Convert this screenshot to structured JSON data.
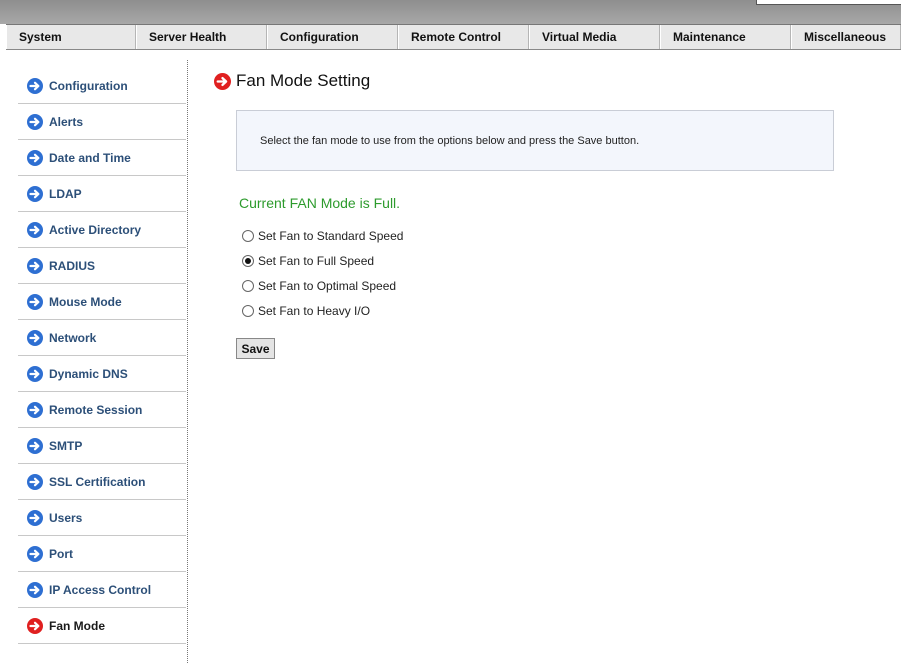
{
  "menu": [
    {
      "label": "System"
    },
    {
      "label": "Server Health"
    },
    {
      "label": "Configuration"
    },
    {
      "label": "Remote Control"
    },
    {
      "label": "Virtual Media"
    },
    {
      "label": "Maintenance"
    },
    {
      "label": "Miscellaneous"
    }
  ],
  "sidebar": {
    "items": [
      {
        "label": "Configuration"
      },
      {
        "label": "Alerts"
      },
      {
        "label": "Date and Time"
      },
      {
        "label": "LDAP"
      },
      {
        "label": "Active Directory"
      },
      {
        "label": "RADIUS"
      },
      {
        "label": "Mouse Mode"
      },
      {
        "label": "Network"
      },
      {
        "label": "Dynamic DNS"
      },
      {
        "label": "Remote Session"
      },
      {
        "label": "SMTP"
      },
      {
        "label": "SSL Certification"
      },
      {
        "label": "Users"
      },
      {
        "label": "Port"
      },
      {
        "label": "IP Access Control"
      },
      {
        "label": "Fan Mode"
      }
    ],
    "active_index": 15
  },
  "content": {
    "title": "Fan Mode Setting",
    "info": "Select the fan mode to use from the options below and press the Save button.",
    "current_mode": "Current FAN Mode is Full.",
    "options": [
      {
        "label": "Set Fan to Standard Speed",
        "checked": false
      },
      {
        "label": "Set Fan to Full Speed",
        "checked": true
      },
      {
        "label": "Set Fan to Optimal Speed",
        "checked": false
      },
      {
        "label": "Set Fan to Heavy I/O",
        "checked": false
      }
    ],
    "save_label": "Save"
  },
  "colors": {
    "nav_arrow": "#2e6fd2",
    "active_arrow": "#e02020",
    "sidebar_text": "#2c4f78",
    "current_mode_text": "#2d9b2d"
  },
  "icons": {
    "nav": "arrow-right-circle-icon",
    "active": "arrow-right-circle-icon"
  }
}
